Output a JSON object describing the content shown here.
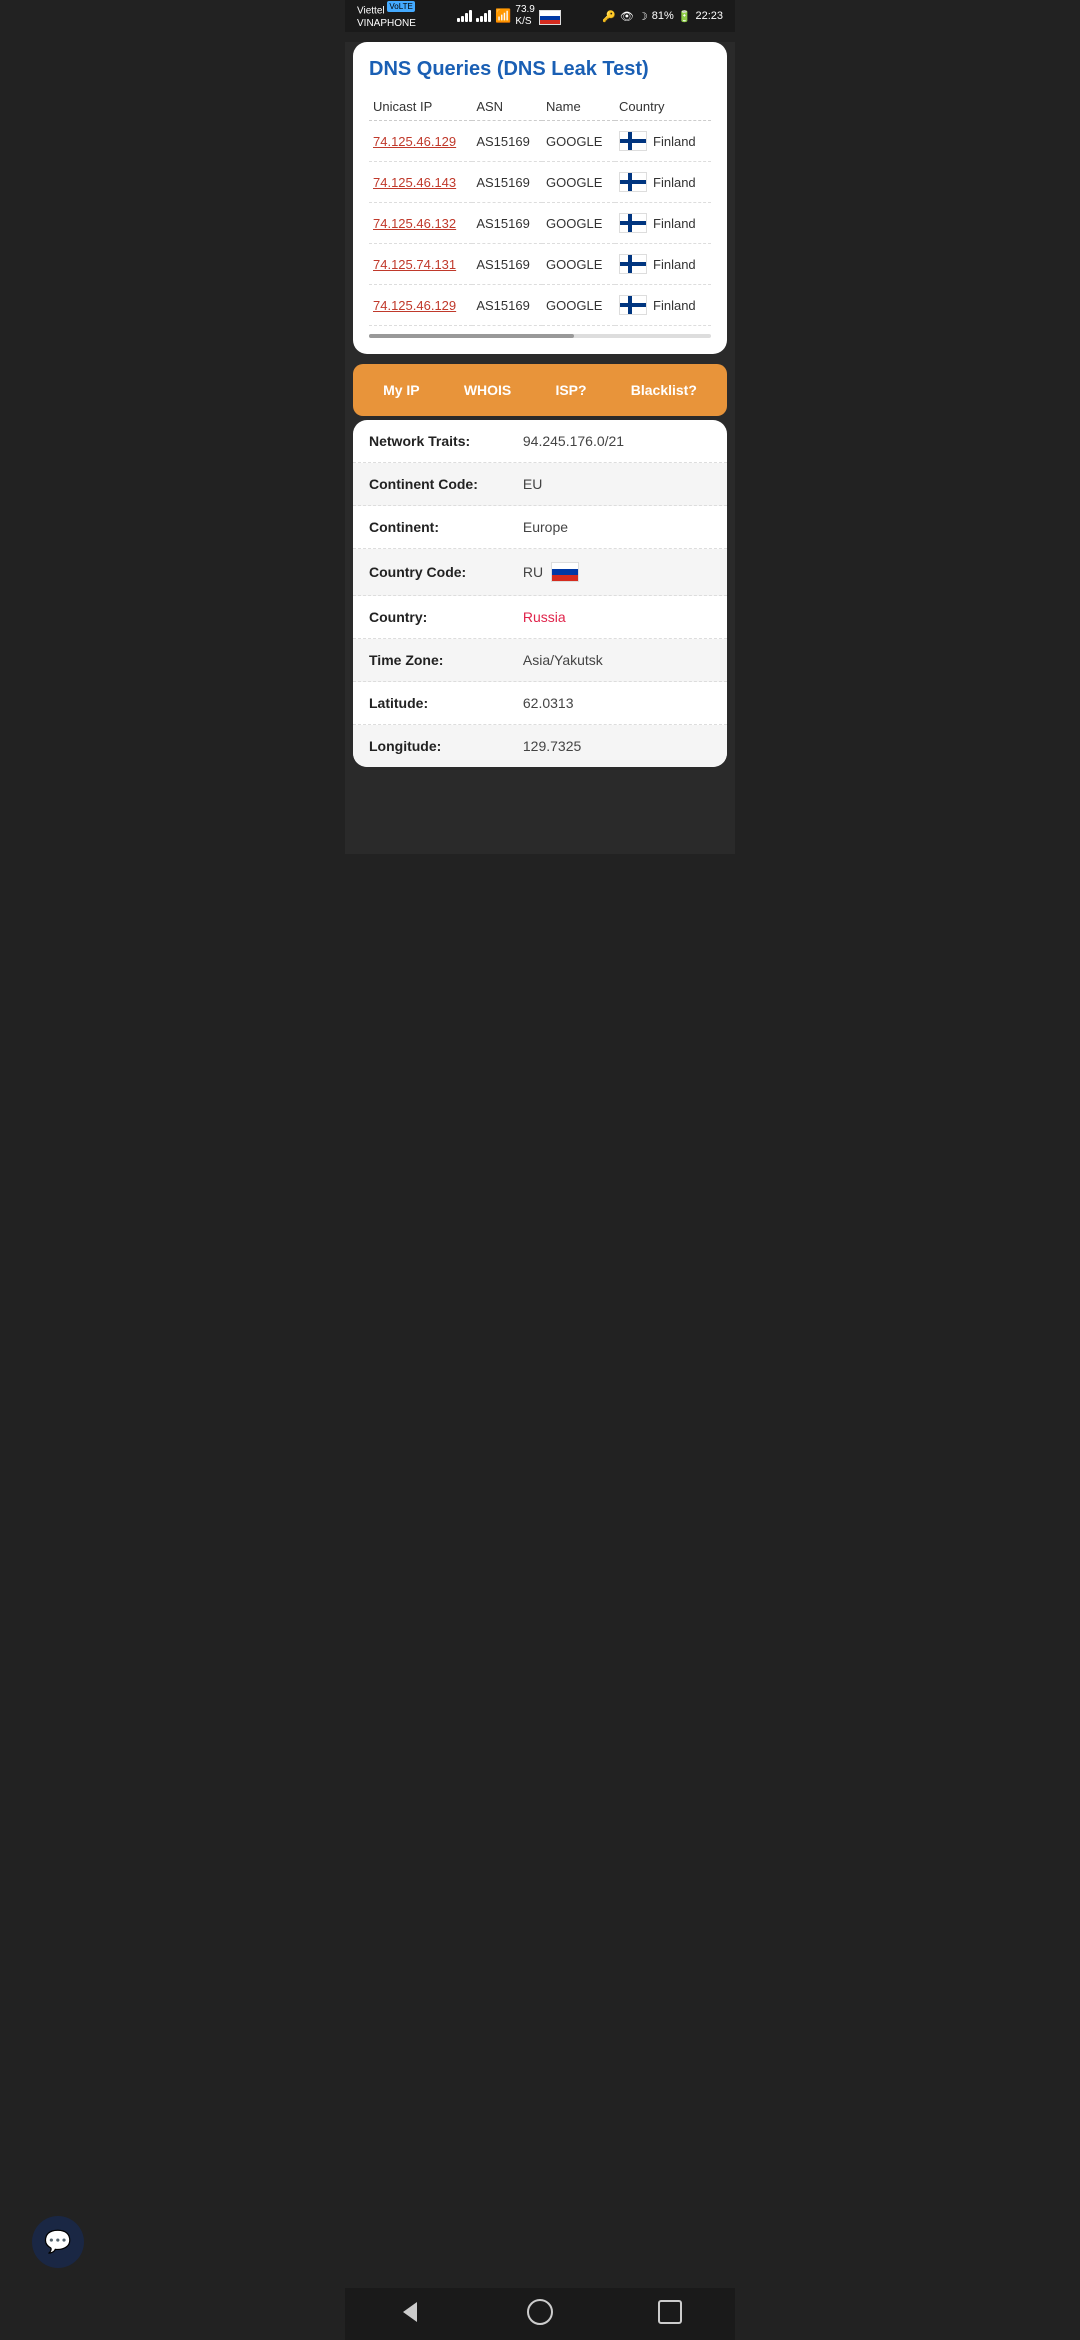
{
  "statusBar": {
    "carrier": "Viettel",
    "network": "VoLTE",
    "provider": "VINAPHONE",
    "speed": "73.9",
    "speedUnit": "K/S",
    "battery": "81%",
    "time": "22:23"
  },
  "dnsCard": {
    "title": "DNS Queries (DNS Leak Test)",
    "columns": [
      "Unicast IP",
      "ASN",
      "Name",
      "Country"
    ],
    "rows": [
      {
        "ip": "74.125.46.129",
        "asn": "AS15169",
        "name": "GOOGLE",
        "country": "Finland",
        "flag": "fi"
      },
      {
        "ip": "74.125.46.143",
        "asn": "AS15169",
        "name": "GOOGLE",
        "country": "Finland",
        "flag": "fi"
      },
      {
        "ip": "74.125.46.132",
        "asn": "AS15169",
        "name": "GOOGLE",
        "country": "Finland",
        "flag": "fi"
      },
      {
        "ip": "74.125.74.131",
        "asn": "AS15169",
        "name": "GOOGLE",
        "country": "Finland",
        "flag": "fi"
      },
      {
        "ip": "74.125.46.129",
        "asn": "AS15169",
        "name": "GOOGLE",
        "country": "Finland",
        "flag": "fi"
      }
    ]
  },
  "navTabs": [
    {
      "label": "My IP",
      "active": false
    },
    {
      "label": "WHOIS",
      "active": false
    },
    {
      "label": "ISP?",
      "active": false
    },
    {
      "label": "Blacklist?",
      "active": false
    }
  ],
  "infoRows": [
    {
      "label": "Network Traits:",
      "value": "94.245.176.0/21",
      "shaded": false,
      "type": "normal"
    },
    {
      "label": "Continent Code:",
      "value": "EU",
      "shaded": true,
      "type": "normal"
    },
    {
      "label": "Continent:",
      "value": "Europe",
      "shaded": false,
      "type": "normal"
    },
    {
      "label": "Country Code:",
      "value": "RU",
      "shaded": true,
      "type": "flag-ru"
    },
    {
      "label": "Country:",
      "value": "Russia",
      "shaded": false,
      "type": "red"
    },
    {
      "label": "Time Zone:",
      "value": "Asia/Yakutsk",
      "shaded": true,
      "type": "normal"
    },
    {
      "label": "Latitude:",
      "value": "62.0313",
      "shaded": false,
      "type": "normal"
    },
    {
      "label": "Longitude:",
      "value": "129.7325",
      "shaded": true,
      "type": "normal"
    }
  ]
}
